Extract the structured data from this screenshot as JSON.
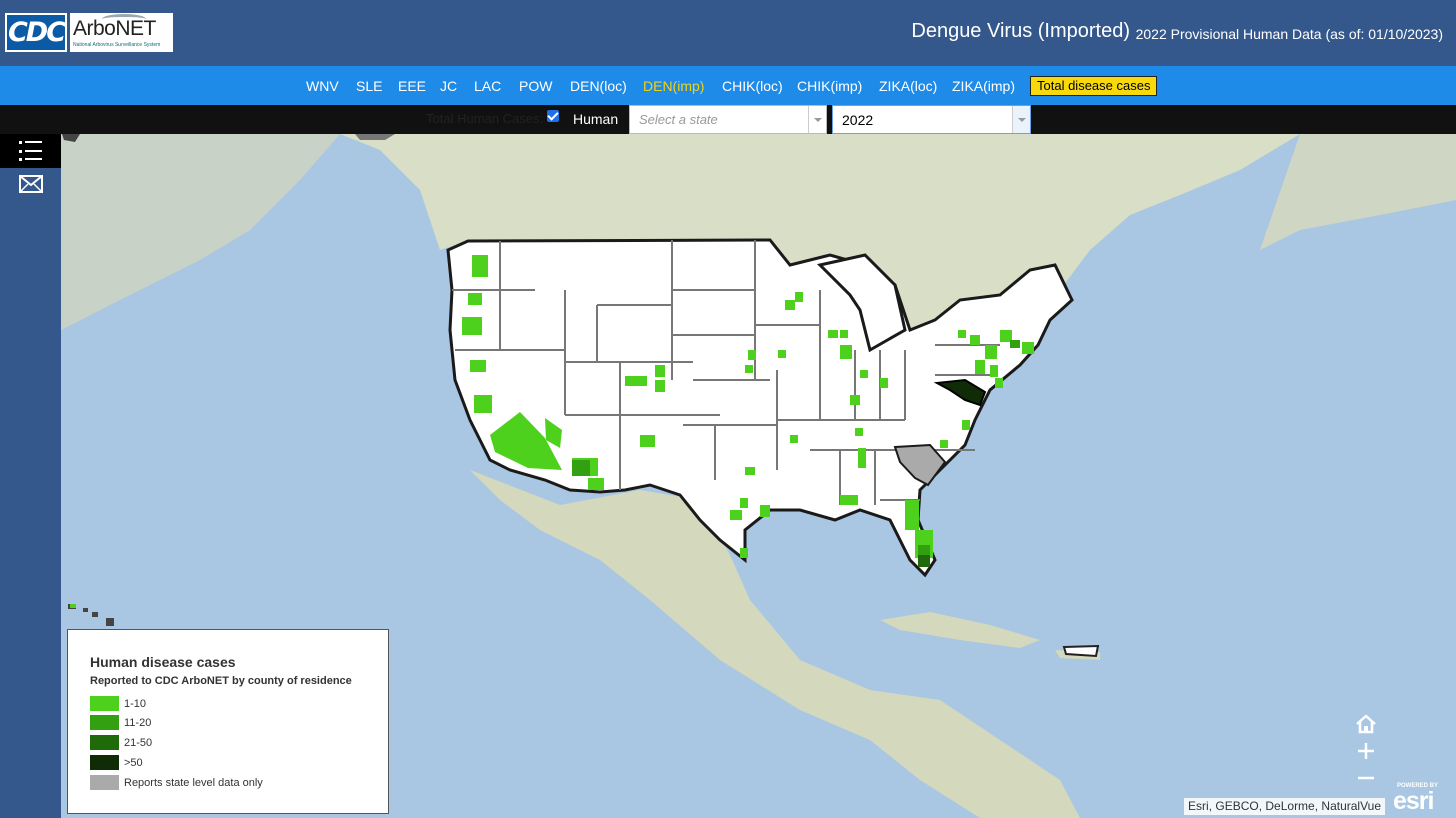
{
  "header": {
    "cdc_logo_text": "CDC",
    "arbonet_logo_text": "ArboNET",
    "arbonet_logo_subtitle": "National Arbovirus Surveillance System",
    "title": "Dengue Virus (Imported)",
    "subtitle": "2022 Provisional Human Data (as of: 01/10/2023)"
  },
  "nav": {
    "items": [
      "WNV",
      "SLE",
      "EEE",
      "JC",
      "LAC",
      "POW",
      "DEN(loc)",
      "DEN(imp)",
      "CHIK(loc)",
      "CHIK(imp)",
      "ZIKA(loc)",
      "ZIKA(imp)"
    ],
    "active": "DEN(imp)",
    "total_button": "Total disease cases",
    "active_color": "#f5d20f",
    "total_button_color": "#f8da0c"
  },
  "filters": {
    "label": "Total Human Cases:",
    "checkbox_label": "Human",
    "checkbox_checked": true,
    "state_placeholder": "Select a state",
    "year_value": "2022"
  },
  "toolbar": {
    "icons": [
      "list-icon",
      "mail-icon"
    ]
  },
  "legend": {
    "title": "Human disease cases",
    "subtitle": "Reported to CDC ArboNET by county of residence",
    "items": [
      {
        "label": "1-10",
        "color": "#4dd11c"
      },
      {
        "label": "11-20",
        "color": "#32a010"
      },
      {
        "label": "21-50",
        "color": "#1f6b0a"
      },
      {
        "label": ">50",
        "color": "#0f2c06"
      },
      {
        "label": "Reports state level data only",
        "color": "#aaaaaa"
      }
    ]
  },
  "map": {
    "state_level_only_states": [
      "South Carolina"
    ],
    "controls": [
      "home-icon",
      "zoom-in-icon",
      "zoom-out-icon"
    ],
    "attribution": "Esri, GEBCO, DeLorme, NaturalVue",
    "powered_by": "POWERED BY",
    "esri_logo": "esri",
    "colors": {
      "ocean": "#a9c7e2",
      "land": "#d9e0c8",
      "us_fill": "#ffffff"
    }
  }
}
